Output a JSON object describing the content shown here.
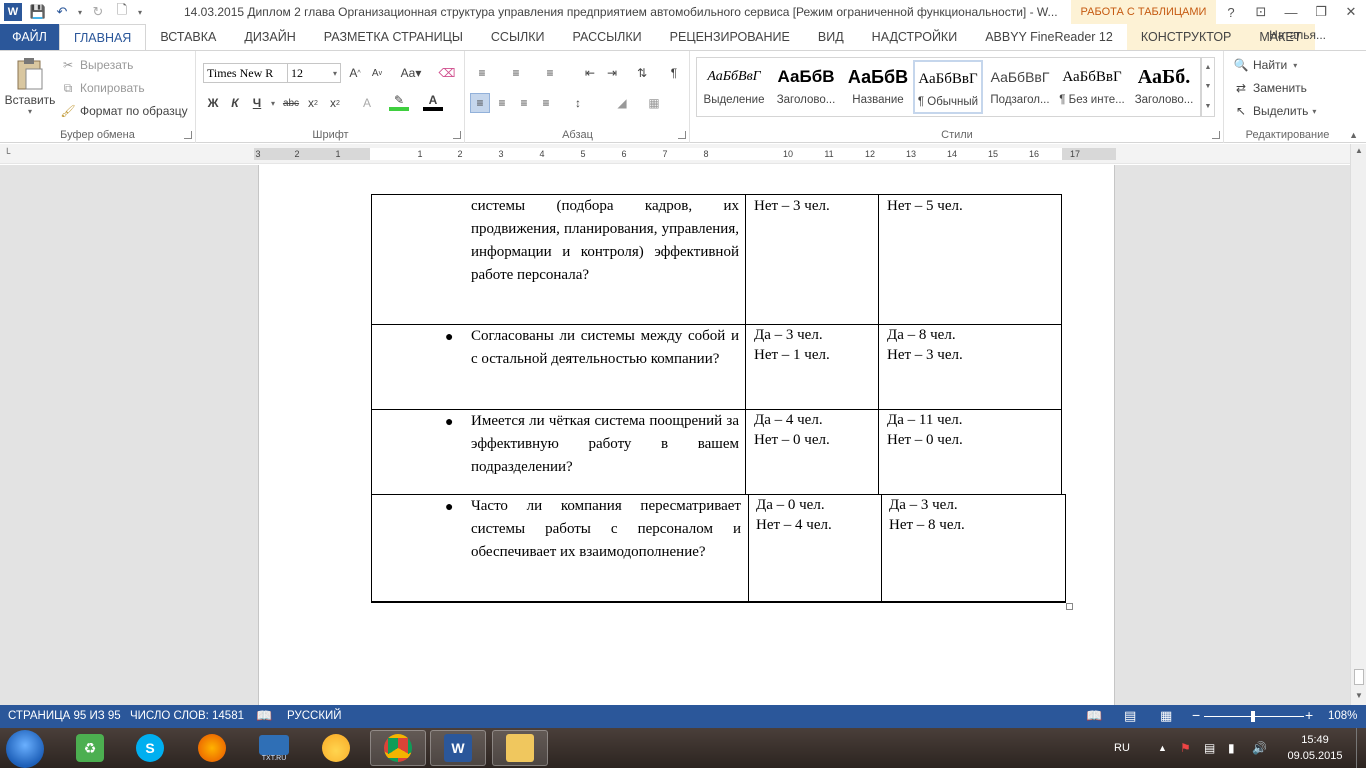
{
  "window": {
    "title": "14.03.2015 Диплом 2 глава Организационная структура управления предприятием автомобильного сервиса [Режим ограниченной функциональности] - W...",
    "contextual_tab_group": "РАБОТА С ТАБЛИЦАМИ",
    "controls": [
      "?",
      "⊡",
      "—",
      "❐",
      "✕"
    ]
  },
  "tabs": [
    "ФАЙЛ",
    "ГЛАВНАЯ",
    "ВСТАВКА",
    "ДИЗАЙН",
    "РАЗМЕТКА СТРАНИЦЫ",
    "ССЫЛКИ",
    "РАССЫЛКИ",
    "РЕЦЕНЗИРОВАНИЕ",
    "ВИД",
    "НАДСТРОЙКИ",
    "ABBYY FineReader 12",
    "КОНСТРУКТОР",
    "МАКЕТ"
  ],
  "user": "Наталья...",
  "ribbon": {
    "clipboard": {
      "label": "Буфер обмена",
      "paste": "Вставить",
      "cut": "Вырезать",
      "copy": "Копировать",
      "format_painter": "Формат по образцу"
    },
    "font": {
      "label": "Шрифт",
      "font_name": "Times New R",
      "font_size": "12"
    },
    "paragraph": {
      "label": "Абзац"
    },
    "styles": {
      "label": "Стили",
      "items": [
        {
          "sample": "АаБбВвГ",
          "name": "Выделение"
        },
        {
          "sample": "АаБбВ",
          "name": "Заголово..."
        },
        {
          "sample": "АаБбВ",
          "name": "Название"
        },
        {
          "sample": "АаБбВвГ",
          "name": "¶ Обычный"
        },
        {
          "sample": "АаБбВвГ",
          "name": "Подзагол..."
        },
        {
          "sample": "АаБбВвГ",
          "name": "¶ Без инте..."
        },
        {
          "sample": "АаБб.",
          "name": "Заголово..."
        }
      ]
    },
    "editing": {
      "label": "Редактирование",
      "find": "Найти",
      "replace": "Заменить",
      "select": "Выделить"
    }
  },
  "ruler_ticks": [
    "3",
    "2",
    "1",
    "1",
    "2",
    "3",
    "4",
    "5",
    "6",
    "7",
    "8",
    "10",
    "11",
    "12",
    "13",
    "14",
    "15",
    "16",
    "17"
  ],
  "table": {
    "rows": [
      {
        "question": "системы (подбора кадров, их продвижения, планирования, управления, информации и контроля) эффективной работе персонала?",
        "bullet": false,
        "col2": [
          "Нет – 3 чел."
        ],
        "col3": [
          "Нет – 5 чел."
        ]
      },
      {
        "question": "Согласованы ли системы между собой и с остальной деятельностью компании?",
        "bullet": true,
        "col2": [
          "Да – 3 чел.",
          "Нет – 1 чел."
        ],
        "col3": [
          "Да – 8 чел.",
          "Нет – 3 чел."
        ]
      },
      {
        "question": "Имеется ли чёткая система поощрений за эффективную работу в вашем подразделении?",
        "bullet": true,
        "col2": [
          "Да – 4 чел.",
          "Нет – 0 чел."
        ],
        "col3": [
          "Да – 11 чел.",
          "Нет – 0 чел."
        ]
      },
      {
        "question": "Часто ли компания пересматривает системы работы с персоналом и обеспечивает их взаимодополнение?",
        "bullet": true,
        "col2": [
          "Да – 0 чел.",
          "Нет – 4 чел."
        ],
        "col3": [
          "Да – 3 чел.",
          "Нет – 8 чел."
        ]
      }
    ]
  },
  "status": {
    "page": "СТРАНИЦА 95 ИЗ 95",
    "words": "ЧИСЛО СЛОВ: 14581",
    "language": "РУССКИЙ",
    "zoom": "108%"
  },
  "taskbar": {
    "lang": "RU",
    "time": "15:49",
    "date": "09.05.2015",
    "txt_label": "TXT.RU"
  }
}
